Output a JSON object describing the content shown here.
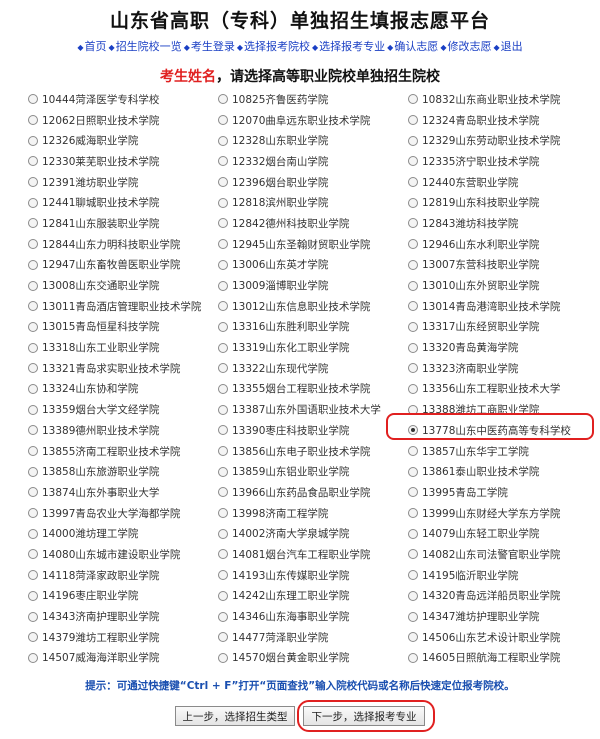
{
  "header": {
    "title": "山东省高职（专科）单独招生填报志愿平台"
  },
  "nav": [
    {
      "label": "首页"
    },
    {
      "label": "招生院校一览"
    },
    {
      "label": "考生登录"
    },
    {
      "label": "选择报考院校"
    },
    {
      "label": "选择报考专业"
    },
    {
      "label": "确认志愿"
    },
    {
      "label": "修改志愿"
    },
    {
      "label": "退出"
    }
  ],
  "prompt": {
    "student_name": "考生姓名",
    "text": "，请选择高等职业院校单独招生院校"
  },
  "selected_school": "13778山东中医药高等专科学校",
  "schools": [
    [
      "10444菏泽医学专科学校",
      "10825齐鲁医药学院",
      "10832山东商业职业技术学院"
    ],
    [
      "12062日照职业技术学院",
      "12070曲阜远东职业技术学院",
      "12324青岛职业技术学院"
    ],
    [
      "12326威海职业学院",
      "12328山东职业学院",
      "12329山东劳动职业技术学院"
    ],
    [
      "12330莱芜职业技术学院",
      "12332烟台南山学院",
      "12335济宁职业技术学院"
    ],
    [
      "12391潍坊职业学院",
      "12396烟台职业学院",
      "12440东营职业学院"
    ],
    [
      "12441聊城职业技术学院",
      "12818滨州职业学院",
      "12819山东科技职业学院"
    ],
    [
      "12841山东服装职业学院",
      "12842德州科技职业学院",
      "12843潍坊科技学院"
    ],
    [
      "12844山东力明科技职业学院",
      "12945山东圣翰财贸职业学院",
      "12946山东水利职业学院"
    ],
    [
      "12947山东畜牧兽医职业学院",
      "13006山东英才学院",
      "13007东营科技职业学院"
    ],
    [
      "13008山东交通职业学院",
      "13009淄博职业学院",
      "13010山东外贸职业学院"
    ],
    [
      "13011青岛酒店管理职业技术学院",
      "13012山东信息职业技术学院",
      "13014青岛港湾职业技术学院"
    ],
    [
      "13015青岛恒星科技学院",
      "13316山东胜利职业学院",
      "13317山东经贸职业学院"
    ],
    [
      "13318山东工业职业学院",
      "13319山东化工职业学院",
      "13320青岛黄海学院"
    ],
    [
      "13321青岛求实职业技术学院",
      "13322山东现代学院",
      "13323济南职业学院"
    ],
    [
      "13324山东协和学院",
      "13355烟台工程职业技术学院",
      "13356山东工程职业技术大学"
    ],
    [
      "13359烟台大学文经学院",
      "13387山东外国语职业技术大学",
      "13388潍坊工商职业学院"
    ],
    [
      "13389德州职业技术学院",
      "13390枣庄科技职业学院",
      "13778山东中医药高等专科学校"
    ],
    [
      "13855济南工程职业技术学院",
      "13856山东电子职业技术学院",
      "13857山东华宇工学院"
    ],
    [
      "13858山东旅游职业学院",
      "13859山东铝业职业学院",
      "13861泰山职业技术学院"
    ],
    [
      "13874山东外事职业大学",
      "13966山东药品食品职业学院",
      "13995青岛工学院"
    ],
    [
      "13997青岛农业大学海都学院",
      "13998济南工程学院",
      "13999山东财经大学东方学院"
    ],
    [
      "14000潍坊理工学院",
      "14002济南大学泉城学院",
      "14079山东轻工职业学院"
    ],
    [
      "14080山东城市建设职业学院",
      "14081烟台汽车工程职业学院",
      "14082山东司法警官职业学院"
    ],
    [
      "14118菏泽家政职业学院",
      "14193山东传媒职业学院",
      "14195临沂职业学院"
    ],
    [
      "14196枣庄职业学院",
      "14242山东理工职业学院",
      "14320青岛远洋船员职业学院"
    ],
    [
      "14343济南护理职业学院",
      "14346山东海事职业学院",
      "14347潍坊护理职业学院"
    ],
    [
      "14379潍坊工程职业学院",
      "14477菏泽职业学院",
      "14506山东艺术设计职业学院"
    ],
    [
      "14507威海海洋职业学院",
      "14570烟台黄金职业学院",
      "14605日照航海工程职业学院"
    ]
  ],
  "tip": "提示：可通过快捷键“Ctrl + F”打开“页面查找”输入院校代码或名称后快速定位报考院校。",
  "buttons": {
    "prev": "上一步，选择招生类型",
    "next": "下一步，选择报考专业"
  },
  "colors": {
    "nav_link": "#1a3fc4",
    "highlight": "#e02020",
    "tip": "#1a4fb0"
  }
}
